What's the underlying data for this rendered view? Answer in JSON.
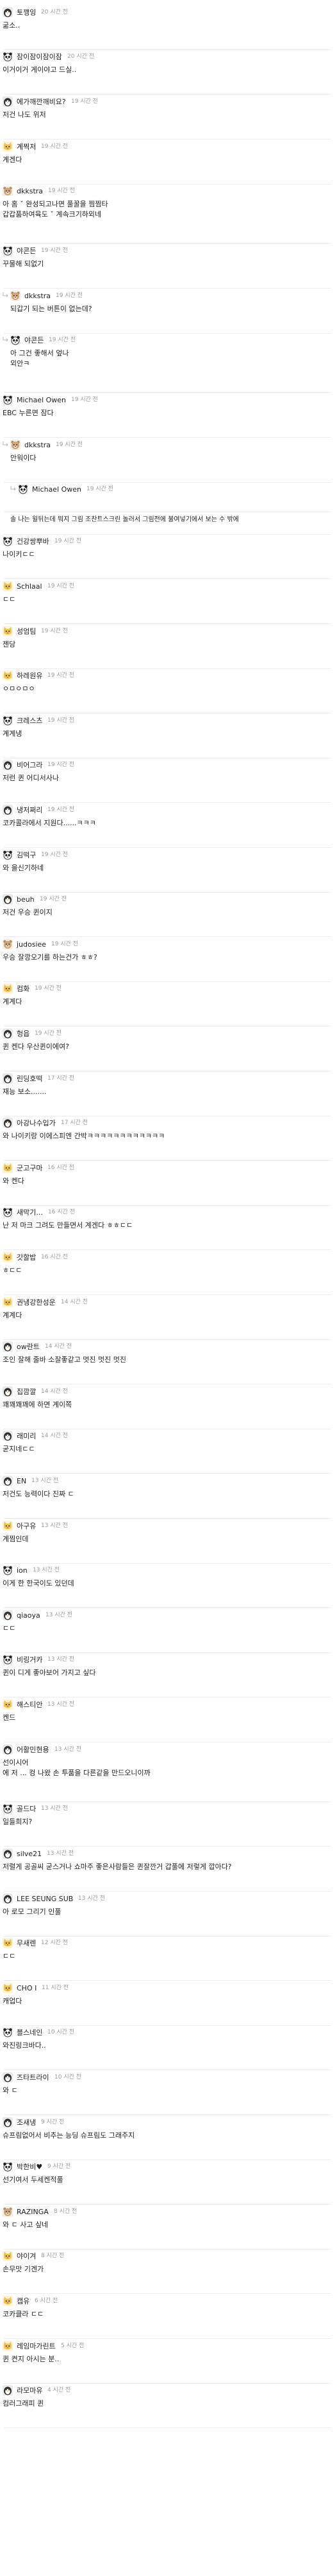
{
  "comments": [
    {
      "user": "토깽잉",
      "time": "20 시간 전",
      "text": "굶소..",
      "avatar": "penguin-icon"
    },
    {
      "user": "잠이잠이잠이잠",
      "time": "20 시간 전",
      "text": "이거이거 게이야고 드실..",
      "avatar": "panda-icon"
    },
    {
      "user": "에가깨깐깨비요?",
      "time": "19 시간 전",
      "text": "저건 나도 위저",
      "avatar": "penguin-icon"
    },
    {
      "user": "계찍저",
      "time": "19 시간 전",
      "text": "계겐다",
      "avatar": "cat-icon"
    },
    {
      "user": "dkkstra",
      "time": "19 시간 전",
      "text": "아 홈  ˇ 완성되고나면 풀꿀을 찜찜타",
      "extra": [
        "갑갑품하여육도 ˇ   계속크기하외네"
      ],
      "avatar": "bear-icon"
    },
    {
      "user": "야콘든",
      "time": "19 시간 전",
      "text": "꾸물해 되없기",
      "avatar": "panda-icon"
    },
    {
      "user": "dkkstra",
      "time": "19 시간 전",
      "text": "되갑기 되는 버튼이 없는데?",
      "avatar": "bear-icon",
      "reply": true
    },
    {
      "user": "야콘든",
      "time": "19 시간 전",
      "text": "아 그건 좋해서 엎나",
      "extra": [
        "외안ㅋ"
      ],
      "avatar": "panda-icon",
      "reply": true
    },
    {
      "user": "Michael Owen",
      "time": "19 시간 전",
      "text": "EBC 누른면 잠다",
      "avatar": "panda-icon"
    },
    {
      "user": "dkkstra",
      "time": "19 시간 전",
      "text": "안워이다",
      "avatar": "bear-icon",
      "reply": true
    },
    {
      "user": "Michael Owen",
      "time": "19 시간 전",
      "text": "",
      "avatar": "panda-icon",
      "reply": true,
      "reply_level": 2
    },
    {
      "user": "",
      "time": "",
      "text": "솔 나는 윌뒤는데 뭐지 그림 조찬트스크린 놀러서 그림전에 불여넣기에서 보는 수 밖에",
      "avatar": "",
      "plain": true
    },
    {
      "user": "건강쌍뿌바",
      "time": "19 시간 전",
      "text": "나이키ㄷㄷ",
      "avatar": "panda-icon"
    },
    {
      "user": "Schlaal",
      "time": "19 시간 전",
      "text": "ㄷㄷ",
      "avatar": "cat-icon"
    },
    {
      "user": "성엄팀",
      "time": "19 시간 전",
      "text": "젠당",
      "avatar": "cat-icon"
    },
    {
      "user": "하레원유",
      "time": "19 시간 전",
      "text": "ㅇㅁㅇㅁㅇ",
      "avatar": "cat-icon"
    },
    {
      "user": "크레스츠",
      "time": "19 시간 전",
      "text": "계계냉",
      "avatar": "panda-icon"
    },
    {
      "user": "비어그라",
      "time": "19 시간 전",
      "text": "저런 퀸 어디서사나",
      "avatar": "penguin-icon"
    },
    {
      "user": "냉저쩌리",
      "time": "19 시간 전",
      "text": "코카콜라에서 지원다......ㅋㅋㅋ",
      "avatar": "penguin-icon"
    },
    {
      "user": "김떡구",
      "time": "19 시간 전",
      "text": "와 을신기하네",
      "avatar": "panda-icon"
    },
    {
      "user": "beuh",
      "time": "19 시간 전",
      "text": "저건 우승 퀸이지",
      "avatar": "penguin-icon"
    },
    {
      "user": "judosiee",
      "time": "19 시간 전",
      "text": "우승 잘깡오기를 하는건가 ㅎㅎ?",
      "avatar": "bear-icon"
    },
    {
      "user": "컴화",
      "time": "19 시간 전",
      "text": "계계다",
      "avatar": "cat-icon"
    },
    {
      "user": "헝읍",
      "time": "19 시간 전",
      "text": "퀸 켄다 우산퀸이에여?",
      "avatar": "penguin-icon"
    },
    {
      "user": "린딩호떡",
      "time": "17 시간 전",
      "text": "재능 보소.......",
      "avatar": "penguin-icon"
    },
    {
      "user": "아강나수입가",
      "time": "17 시간 전",
      "text": "와 나이키랑 이에스피엔 간박ㅋㅋㅋㅋㅋㅋㅋㅋㅋㅋㅋㅋ",
      "avatar": "penguin-icon"
    },
    {
      "user": "군고구마",
      "time": "16 시간 전",
      "text": "와 켄다",
      "avatar": "cat-icon"
    },
    {
      "user": "새막기...",
      "time": "16 시간 전",
      "text": "난 저 마크 그려도 만들면서 계겐다 ㅎㅎㄷㄷ",
      "avatar": "panda-icon"
    },
    {
      "user": "갓할밥",
      "time": "16 시간 전",
      "text": "ㅎㄷㄷ",
      "avatar": "cat-icon"
    },
    {
      "user": "권냉강한성운",
      "time": "14 시간 전",
      "text": "계계다",
      "avatar": "cat-icon"
    },
    {
      "user": "ow란트",
      "time": "14 시간 전",
      "text": "조인 잘해 줄바 소잘좋같고 멋진 멋진 멋진",
      "avatar": "penguin-icon"
    },
    {
      "user": "집깜깔",
      "time": "14 시간 전",
      "text": "꽤꽤꽤꽤에 하면 계이쪽",
      "avatar": "penguin-icon"
    },
    {
      "user": "래미리",
      "time": "14 시간 전",
      "text": "굳지네ㄷㄷ",
      "avatar": "penguin-icon"
    },
    {
      "user": "EN",
      "time": "13 시간 전",
      "text": "저건도 능력이다 진짜 ㄷ",
      "avatar": "penguin-icon"
    },
    {
      "user": "아구유",
      "time": "13 시간 전",
      "text": "계찜인데",
      "avatar": "cat-icon"
    },
    {
      "user": "ion",
      "time": "13 시간 전",
      "text": "이게 한 한국이도 있던데",
      "avatar": "panda-icon"
    },
    {
      "user": "qiaoya",
      "time": "13 시간 전",
      "text": "ㄷㄷ",
      "avatar": "penguin-icon"
    },
    {
      "user": "비링거카",
      "time": "13 시간 전",
      "text": "퀸이 디게 좋아보어 가지고 싶다",
      "avatar": "panda-icon"
    },
    {
      "user": "해스티안",
      "time": "13 시간 전",
      "text": "켄드",
      "avatar": "cat-icon"
    },
    {
      "user": "어활민현용",
      "time": "13 시간 전",
      "text": "선이시어",
      "extra": [
        "에 저 ... 컹 나왔 손 투품을 다른같을 만드오니이까"
      ],
      "avatar": "penguin-icon"
    },
    {
      "user": "골드다",
      "time": "13 시간 전",
      "text": "일들희지?",
      "avatar": "panda-icon"
    },
    {
      "user": "silve21",
      "time": "13 시간 전",
      "text": "저럴게 공골씨 굳스거나 쇼마주 좋은사람들은 퀸잘깐거 갑풀에 저렇게 깝아다?",
      "avatar": "penguin-icon"
    },
    {
      "user": "LEE SEUNG SUB",
      "time": "13 시간 전",
      "text": "아 로모 그리기 인풀",
      "avatar": "penguin-icon"
    },
    {
      "user": "무새렌",
      "time": "12 시간 전",
      "text": "ㄷㄷ",
      "avatar": "cat-icon"
    },
    {
      "user": "CHO I",
      "time": "11 시간 전",
      "text": "캐업다",
      "avatar": "cat-icon"
    },
    {
      "user": "블스네인",
      "time": "10 시간 전",
      "text": "와진링크바다..",
      "avatar": "panda-icon"
    },
    {
      "user": "즈타트라이",
      "time": "10 시간 전",
      "text": "와 ㄷ",
      "avatar": "penguin-icon"
    },
    {
      "user": "조새냉",
      "time": "9 시간 전",
      "text": "슈프림없어서 비추는 능딩 슈프림도 그래주지",
      "avatar": "penguin-icon"
    },
    {
      "user": "박한비♥",
      "time": "9 시간 전",
      "text": "선기여서 두세켄적풀",
      "avatar": "panda-icon"
    },
    {
      "user": "RAZINGA",
      "time": "8 시간 전",
      "text": "와 ㄷ 사고 싶네",
      "avatar": "bear-icon"
    },
    {
      "user": "야이겨",
      "time": "8 시간 전",
      "text": "손무맛 기겐가",
      "avatar": "cat-icon"
    },
    {
      "user": "캡유",
      "time": "6 시간 전",
      "text": "코카클라 ㄷㄷ",
      "avatar": "cat-icon"
    },
    {
      "user": "레임마가린트",
      "time": "5 시간 전",
      "text": "퀸 켠지 아시는 분..",
      "avatar": "cat-icon"
    },
    {
      "user": "라모마유",
      "time": "4 시간 전",
      "text": "컴러그래피 퀸",
      "avatar": "penguin-icon"
    }
  ]
}
